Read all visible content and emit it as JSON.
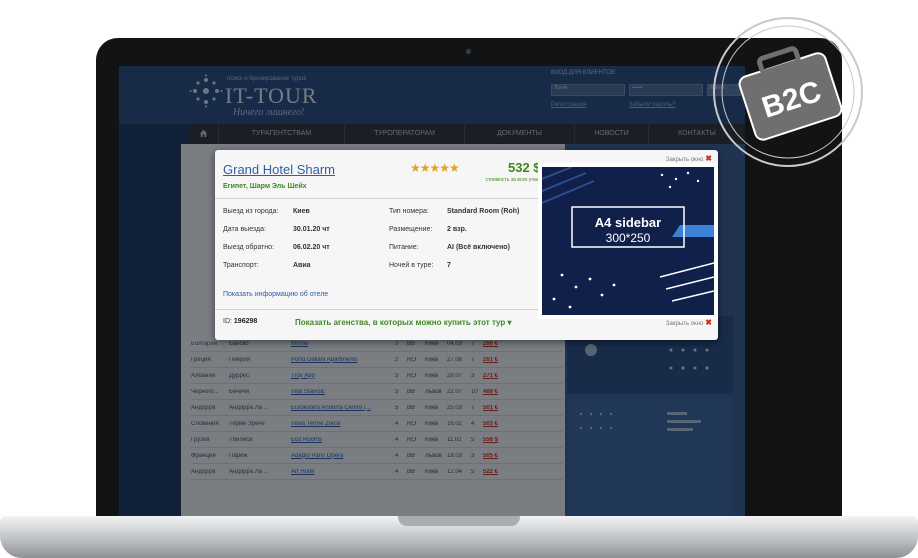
{
  "site": {
    "logo_tagline": "поиск и бронирование туров",
    "logo_text": "IT-TOUR",
    "logo_slogan": "Ничего лишнего!",
    "client_login_title": "ВХОД ДЛЯ КЛИЕНТОВ",
    "login_placeholder": "Логин",
    "password_placeholder": "••••••",
    "login_button": "Войти",
    "register_link": "Регистрация",
    "forgot_link": "Забыли пароль?"
  },
  "nav": {
    "home_icon": "home-icon",
    "items": [
      "ТУРАГЕНТСТВАМ",
      "ТУРОПЕРАТОРАМ",
      "ДОКУМЕНТЫ",
      "НОВОСТИ",
      "КОНТАКТЫ"
    ]
  },
  "tours_table": {
    "rows": [
      {
        "country": "Болгария",
        "city": "Банско",
        "hotel": "Mishel",
        "stars": "3",
        "meal": "BB",
        "from": "Киев",
        "date": "04.03",
        "nights": "7",
        "price": "260 €"
      },
      {
        "country": "Греция",
        "city": "Пиерия",
        "hotel": "Porto Dallani Apartments",
        "stars": "2",
        "meal": "RO",
        "from": "Киев",
        "date": "27.08",
        "nights": "7",
        "price": "261 €"
      },
      {
        "country": "Албания",
        "city": "Дуррес",
        "hotel": "Troy App",
        "stars": "3",
        "meal": "RO",
        "from": "Киев",
        "date": "29.07",
        "nights": "3",
        "price": "271 €"
      },
      {
        "country": "Черного...",
        "city": "Бечичи",
        "hotel": "Villa Stanisic",
        "stars": "3",
        "meal": "BB",
        "from": "Львов",
        "date": "22.07",
        "nights": "10",
        "price": "488 €"
      },
      {
        "country": "Андорра",
        "city": "Андорра Ла ...",
        "hotel": "Euroesters Andorra Centre (...",
        "stars": "5",
        "meal": "BB",
        "from": "Киев",
        "date": "25.03",
        "nights": "7",
        "price": "501 €"
      },
      {
        "country": "Словения",
        "city": "Терме Зрече",
        "hotel": "Villas Terme Zrece",
        "stars": "4",
        "meal": "RO",
        "from": "Киев",
        "date": "16.02",
        "nights": "4",
        "price": "503 €"
      },
      {
        "country": "Грузия",
        "city": "Тбилиси",
        "hotel": "Eco Rooms",
        "stars": "4",
        "meal": "RO",
        "from": "Киев",
        "date": "11.02",
        "nights": "5",
        "price": "556 $"
      },
      {
        "country": "Франция",
        "city": "Париж",
        "hotel": "Adagio Paris Opera",
        "stars": "4",
        "meal": "BB",
        "from": "Львов",
        "date": "18.03",
        "nights": "3",
        "price": "505 €"
      },
      {
        "country": "Андорра",
        "city": "Андорра Ла ...",
        "hotel": "Art Hotel",
        "stars": "4",
        "meal": "BB",
        "from": "Киев",
        "date": "12.04",
        "nights": "5",
        "price": "522 €"
      }
    ]
  },
  "popup": {
    "close_label": "Закрыть окно",
    "hotel_name": "Grand Hotel Sharm",
    "location": "Египет, Шарм Эль Шейх",
    "stars": "★★★★★",
    "price": "532 $",
    "price_note": "стоимость за всех участников тура",
    "details": {
      "departure_city_label": "Выезд из города:",
      "departure_city": "Киев",
      "departure_date_label": "Дата выезда:",
      "departure_date": "30.01.20 чт",
      "return_date_label": "Выезд обратно:",
      "return_date": "06.02.20 чт",
      "transport_label": "Транспорт:",
      "transport": "Авиа",
      "room_type_label": "Тип номера:",
      "room_type": "Standard Room (Roh)",
      "accommodation_label": "Размещение:",
      "accommodation": "2 взр.",
      "meal_label": "Питание:",
      "meal": "AI (Всё включено)",
      "nights_label": "Ночей в туре:",
      "nights": "7"
    },
    "show_hotel_info": "Показать информацию об отеле",
    "id_label": "ID:",
    "id_value": "196298",
    "show_agencies": "Показать агенства, в которых можно купить этот тур"
  },
  "ad": {
    "title": "A4 sidebar",
    "size": "300*250"
  },
  "badge": {
    "text": "B2C",
    "icon": "briefcase-icon"
  },
  "colors": {
    "header_blue": "#2a4f86",
    "ad_navy": "#10204a",
    "price_green": "#3d8b1f",
    "star_gold": "#e1a523",
    "close_red": "#d62b1f"
  }
}
